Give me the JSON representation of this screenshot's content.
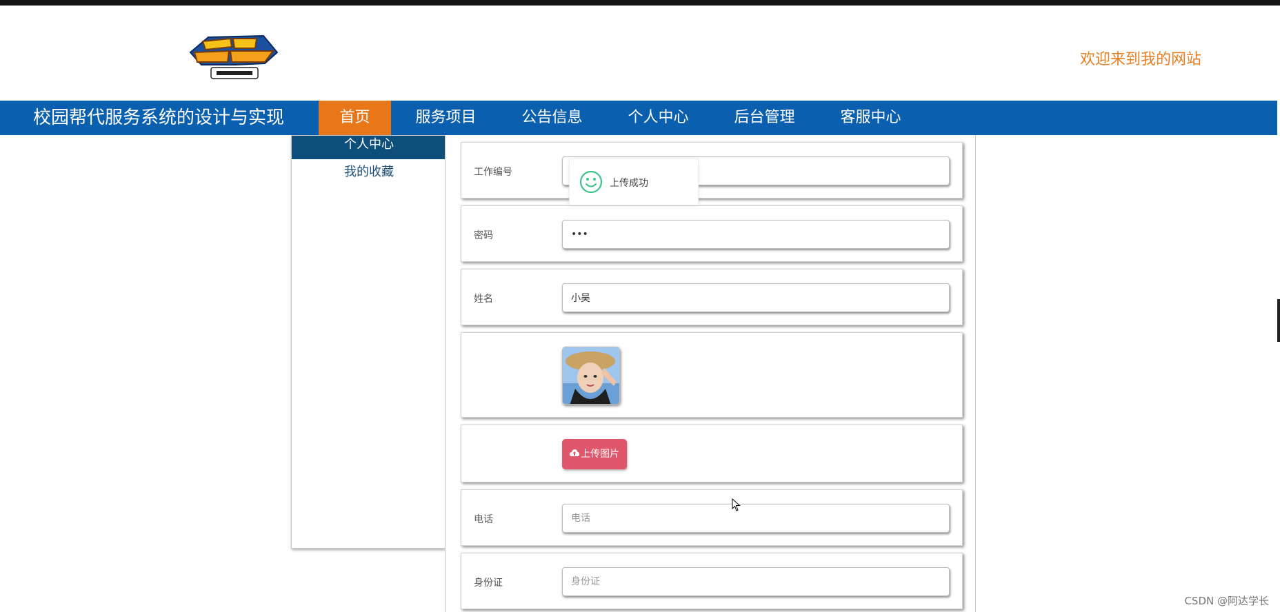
{
  "header": {
    "welcome_text": "欢迎来到我的网站",
    "logo_icon": "digimon-adventure-logo"
  },
  "nav": {
    "site_title": "校园帮代服务系统的设计与实现",
    "items": [
      {
        "label": "首页",
        "active": true
      },
      {
        "label": "服务项目",
        "active": false
      },
      {
        "label": "公告信息",
        "active": false
      },
      {
        "label": "个人中心",
        "active": false
      },
      {
        "label": "后台管理",
        "active": false
      },
      {
        "label": "客服中心",
        "active": false
      }
    ]
  },
  "sidebar": {
    "heading": "个人中心",
    "links": [
      "我的收藏"
    ]
  },
  "form": {
    "job_number": {
      "label": "工作编号",
      "value": ""
    },
    "password": {
      "label": "密码",
      "value": "•••"
    },
    "name": {
      "label": "姓名",
      "value": "小吴"
    },
    "avatar_icon": "user-photo",
    "upload_button": "上传图片",
    "phone": {
      "label": "电话",
      "placeholder": "电话",
      "value": ""
    },
    "id_card": {
      "label": "身份证",
      "placeholder": "身份证",
      "value": ""
    }
  },
  "toast": {
    "text": "上传成功",
    "icon": "smile-icon"
  },
  "watermark": "CSDN @阿达学长",
  "colors": {
    "nav_bg": "#0b5faf",
    "nav_active": "#e8771a",
    "welcome": "#e67e22",
    "sidebar_head": "#0d4e7a",
    "upload_button": "#e0566a",
    "toast_icon": "#3cc48b"
  }
}
